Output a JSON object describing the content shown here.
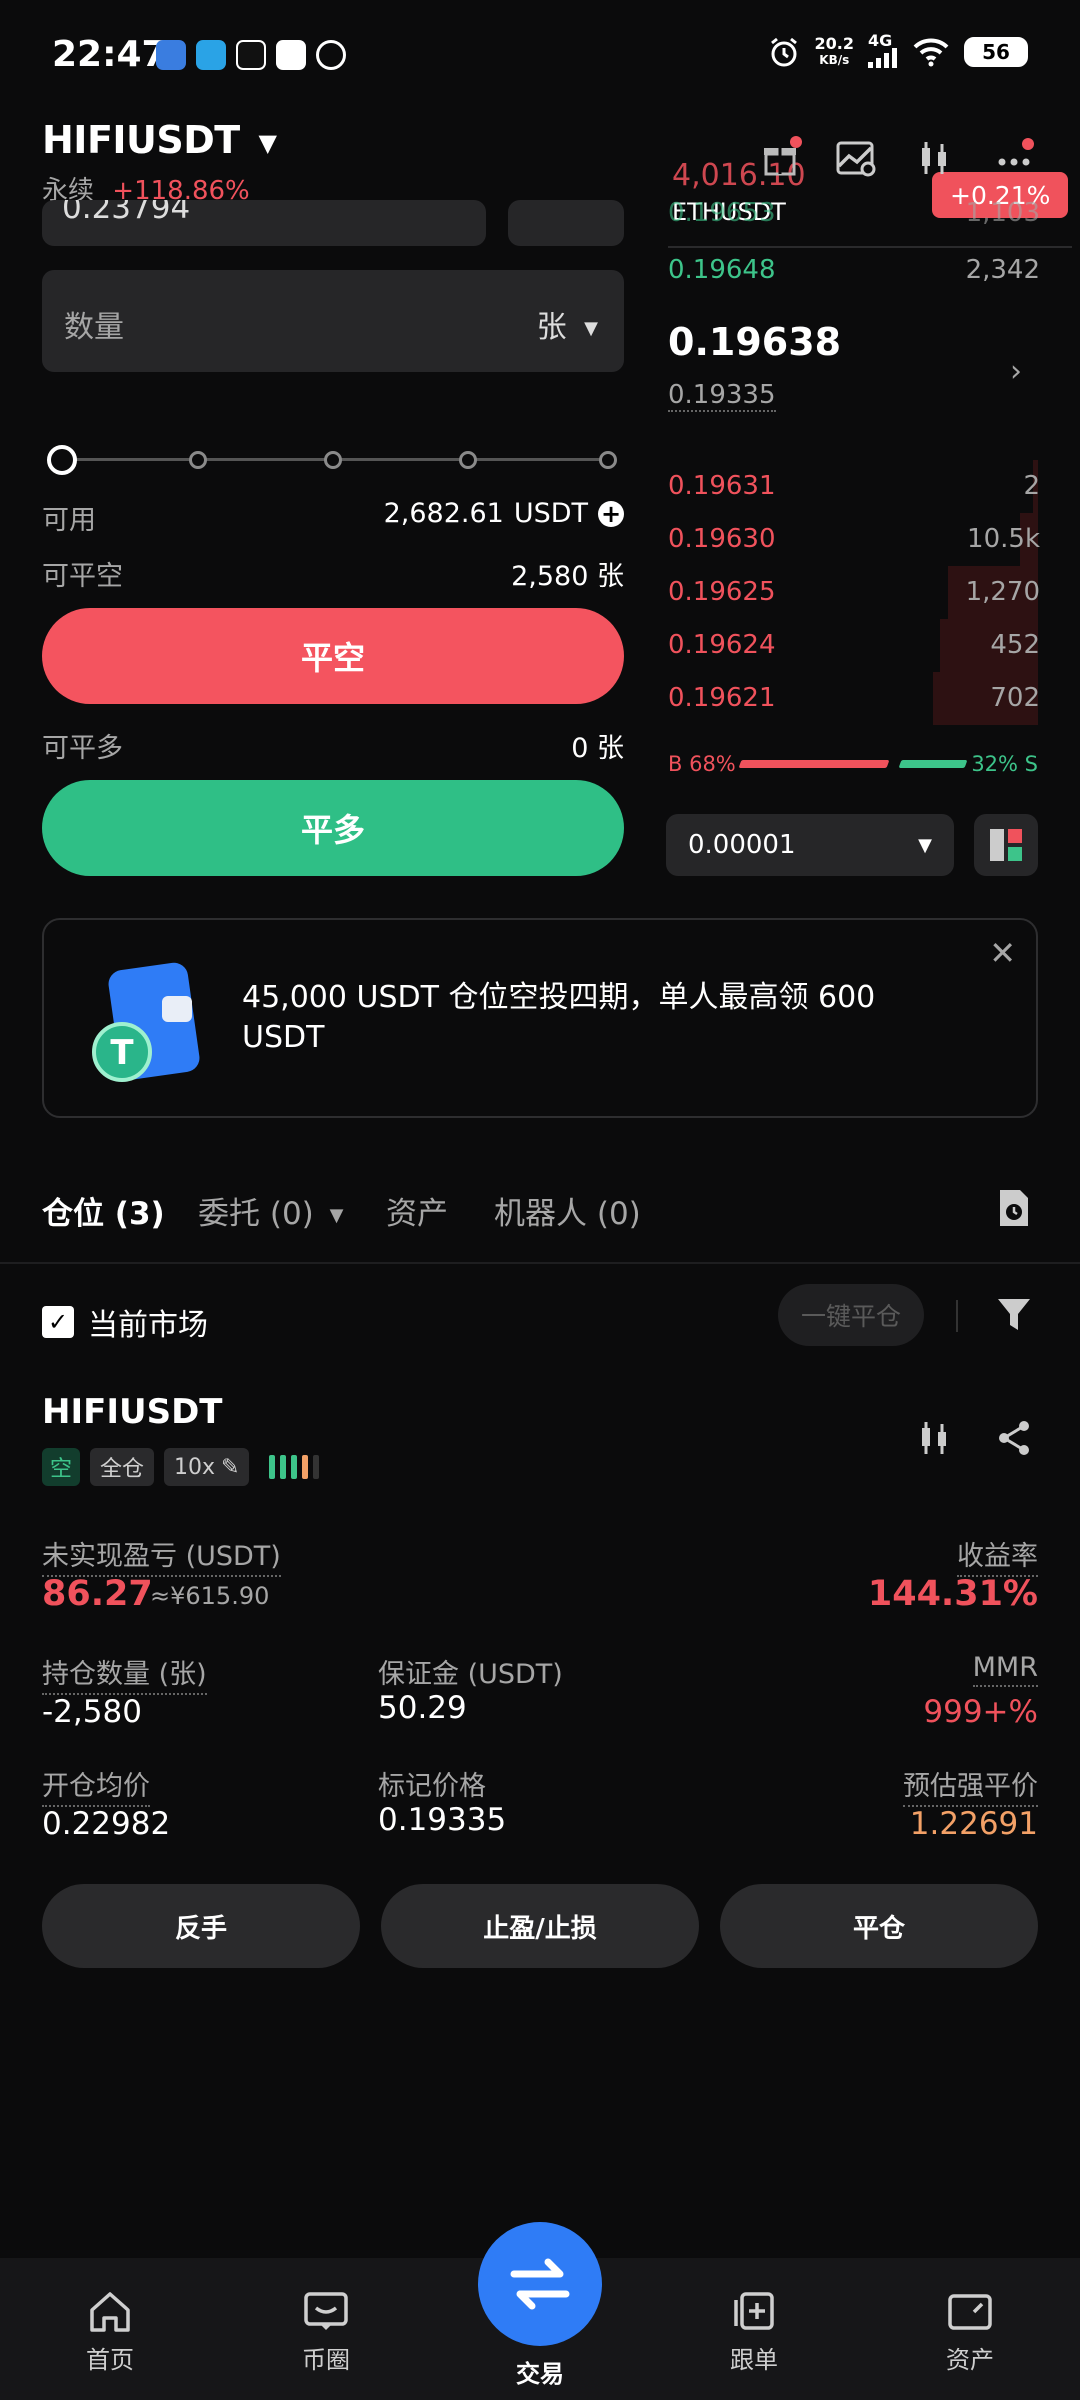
{
  "status_bar": {
    "time": "22:47",
    "net_speed": "20.2",
    "net_unit": "KB/s",
    "network": "4G",
    "battery": "56"
  },
  "header": {
    "pair": "HIFIUSDT",
    "contract_type": "永续",
    "change": "+118.86%",
    "ticker_price": "4,016.10",
    "ticker_symbol": "ETHUSDT",
    "ticker_change": "+0.21%"
  },
  "order_form": {
    "price_value": "0.23794",
    "quantity_placeholder": "数量",
    "quantity_unit": "张",
    "available_label": "可用",
    "available_value": "2,682.61",
    "available_unit": "USDT",
    "close_short_avail_label": "可平空",
    "close_short_avail_value": "2,580 张",
    "close_short_button": "平空",
    "close_long_avail_label": "可平多",
    "close_long_avail_value": "0 张",
    "close_long_button": "平多"
  },
  "order_book": {
    "top_partial": {
      "price": "0.19653",
      "qty": "1,103"
    },
    "bids_top": [
      {
        "price": "0.19648",
        "qty": "2,342"
      }
    ],
    "last_price": "0.19638",
    "mark_price": "0.19335",
    "asks": [
      {
        "price": "0.19631",
        "qty": "2",
        "depth": 0.03
      },
      {
        "price": "0.19630",
        "qty": "10.5k",
        "depth": 0.12
      },
      {
        "price": "0.19625",
        "qty": "1,270",
        "depth": 0.6
      },
      {
        "price": "0.19624",
        "qty": "452",
        "depth": 0.65
      },
      {
        "price": "0.19621",
        "qty": "702",
        "depth": 0.7
      }
    ],
    "buy_ratio_label": "B 68%",
    "sell_ratio_label": "32% S",
    "buy_ratio": 0.68,
    "precision": "0.00001"
  },
  "banner": {
    "text": "45,000 USDT 仓位空投四期，单人最高领 600 USDT"
  },
  "tabs": {
    "positions": "仓位 (3)",
    "orders": "委托 (0)",
    "assets": "资产",
    "bots": "机器人 (0)"
  },
  "filter": {
    "current_market": "当前市场",
    "close_all": "一键平仓"
  },
  "position": {
    "symbol": "HIFIUSDT",
    "side": "空",
    "margin_mode": "全仓",
    "leverage": "10x",
    "pnl_label": "未实现盈亏 (USDT)",
    "pnl_value": "86.27",
    "pnl_cny": "≈¥615.90",
    "roe_label": "收益率",
    "roe_value": "144.31%",
    "size_label": "持仓数量 (张)",
    "size_value": "-2,580",
    "margin_label": "保证金 (USDT)",
    "margin_value": "50.29",
    "mmr_label": "MMR",
    "mmr_value": "999+%",
    "entry_label": "开仓均价",
    "entry_value": "0.22982",
    "mark_label": "标记价格",
    "mark_value": "0.19335",
    "liq_label": "预估强平价",
    "liq_value": "1.22691",
    "btn_reverse": "反手",
    "btn_tpsl": "止盈/止损",
    "btn_close": "平仓"
  },
  "nav": {
    "home": "首页",
    "circle": "币圈",
    "trade": "交易",
    "copy": "跟单",
    "assets": "资产"
  },
  "colors": {
    "red": "#f0525c",
    "green": "#3dc48a",
    "blue": "#2f7cf6",
    "orange": "#f3a167"
  }
}
